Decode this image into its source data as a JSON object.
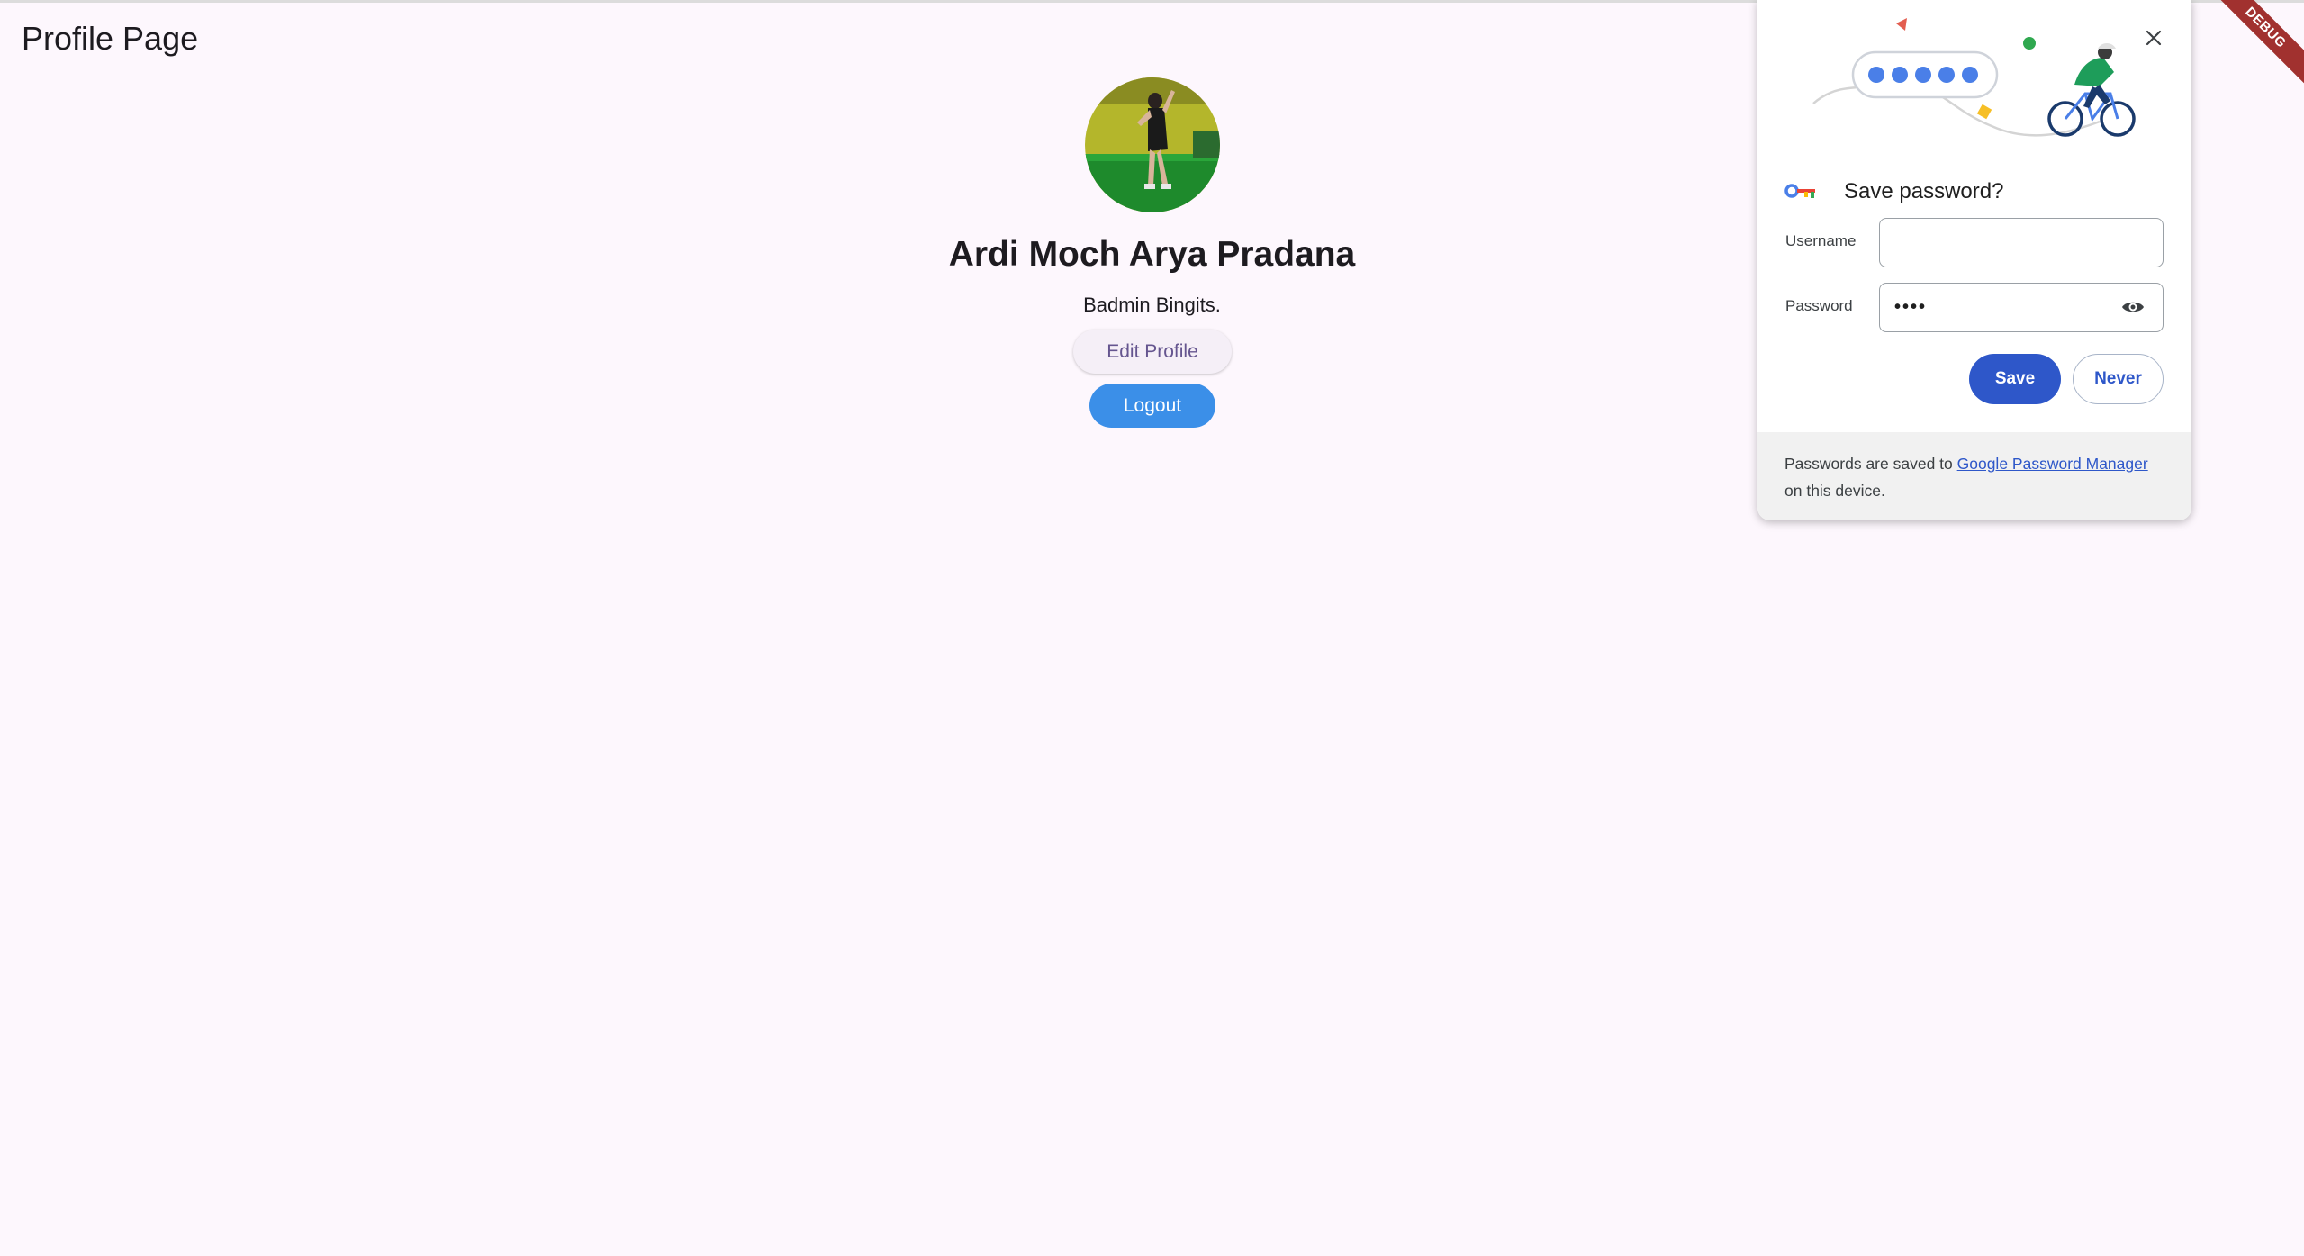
{
  "app_bar": {
    "title": "Profile Page"
  },
  "profile": {
    "name": "Ardi Moch Arya Pradana",
    "subtitle": "Badmin Bingits.",
    "edit_button": "Edit Profile",
    "logout_button": "Logout"
  },
  "debug_banner": "DEBUG",
  "password_dialog": {
    "title": "Save password?",
    "username_label": "Username",
    "username_value": "",
    "password_label": "Password",
    "password_value": "••••",
    "save_button": "Save",
    "never_button": "Never",
    "footer_text_before": "Passwords are saved to ",
    "footer_link": "Google Password Manager",
    "footer_text_after": "on this device."
  },
  "colors": {
    "background": "#fdf7fd",
    "logout_button": "#3b8fe8",
    "edit_button_text": "#65558f",
    "dialog_save": "#2e57c9",
    "debug_ribbon": "#a1312f"
  },
  "icons": [
    "close-icon",
    "key-icon",
    "eye-icon",
    "cyclist-illustration"
  ]
}
